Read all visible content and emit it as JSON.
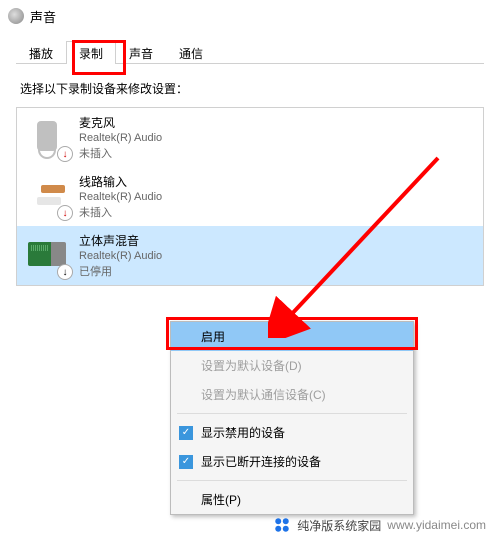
{
  "window": {
    "title": "声音"
  },
  "tabs": {
    "playback": "播放",
    "recording": "录制",
    "sounds": "声音",
    "communications": "通信"
  },
  "instruction": "选择以下录制设备来修改设置：",
  "devices": {
    "mic": {
      "name": "麦克风",
      "driver": "Realtek(R) Audio",
      "status": "未插入"
    },
    "linein": {
      "name": "线路输入",
      "driver": "Realtek(R) Audio",
      "status": "未插入"
    },
    "stereo": {
      "name": "立体声混音",
      "driver": "Realtek(R) Audio",
      "status": "已停用"
    }
  },
  "context_menu": {
    "enable": "启用",
    "set_default": "设置为默认设备(D)",
    "set_default_comm": "设置为默认通信设备(C)",
    "show_disabled": "显示禁用的设备",
    "show_disconnected": "显示已断开连接的设备",
    "properties": "属性(P)"
  },
  "footer": {
    "brand": "纯净版系统家园",
    "url": "www.yidaimei.com"
  }
}
